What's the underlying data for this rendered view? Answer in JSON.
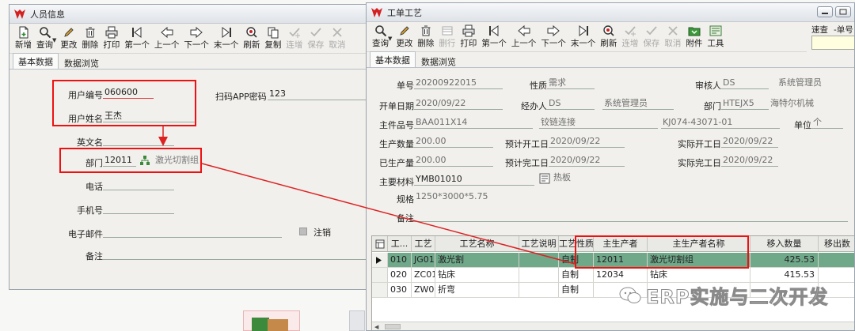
{
  "left_window": {
    "title": "人员信息",
    "toolbar": [
      {
        "label": "新增",
        "icon": "new-doc-icon"
      },
      {
        "label": "查询",
        "icon": "search-icon",
        "dropdown": true
      },
      {
        "label": "更改",
        "icon": "pencil-icon"
      },
      {
        "label": "删除",
        "icon": "trash-icon"
      },
      {
        "label": "打印",
        "icon": "printer-icon"
      },
      {
        "label": "第一个",
        "icon": "first-record-icon"
      },
      {
        "label": "上一个",
        "icon": "prev-record-icon"
      },
      {
        "label": "下一个",
        "icon": "next-record-icon"
      },
      {
        "label": "末一个",
        "icon": "last-record-icon"
      },
      {
        "label": "刷新",
        "icon": "refresh-icon"
      },
      {
        "label": "复制",
        "icon": "copy-icon"
      },
      {
        "label": "连增",
        "icon": "check-plus-icon",
        "disabled": true
      },
      {
        "label": "保存",
        "icon": "check-icon",
        "disabled": true
      },
      {
        "label": "取消",
        "icon": "cancel-icon",
        "disabled": true
      }
    ],
    "tabs": [
      "基本数据",
      "数据浏览"
    ],
    "fields": {
      "user_code_label": "用户编号",
      "user_code": "060600",
      "user_name_label": "用户姓名",
      "user_name": "王杰",
      "english_name_label": "英文名",
      "english_name": "",
      "dept_label": "部门",
      "dept_code": "12011",
      "dept_name": "激光切割组",
      "phone_label": "电话",
      "phone": "",
      "mobile_label": "手机号",
      "mobile": "",
      "email_label": "电子邮件",
      "email": "",
      "remark_label": "备注",
      "remark": "",
      "app_pwd_label": "扫码APP密码",
      "app_pwd": "123",
      "cancel_label": "注销"
    }
  },
  "right_window": {
    "title": "工单工艺",
    "toolbar": [
      {
        "label": "查询",
        "icon": "search-icon",
        "dropdown": true
      },
      {
        "label": "更改",
        "icon": "pencil-icon"
      },
      {
        "label": "删除",
        "icon": "trash-icon"
      },
      {
        "label": "删行",
        "icon": "delete-row-icon",
        "disabled": true
      },
      {
        "label": "打印",
        "icon": "printer-icon"
      },
      {
        "label": "第一个",
        "icon": "first-record-icon"
      },
      {
        "label": "上一个",
        "icon": "prev-record-icon"
      },
      {
        "label": "下一个",
        "icon": "next-record-icon"
      },
      {
        "label": "末一个",
        "icon": "last-record-icon"
      },
      {
        "label": "刷新",
        "icon": "refresh-icon"
      },
      {
        "label": "连增",
        "icon": "check-plus-icon",
        "disabled": true
      },
      {
        "label": "保存",
        "icon": "check-icon",
        "disabled": true
      },
      {
        "label": "取消",
        "icon": "cancel-icon",
        "disabled": true
      },
      {
        "label": "附件",
        "icon": "folder-icon"
      },
      {
        "label": "工具",
        "icon": "tools-icon"
      }
    ],
    "quick_search_label": "速查",
    "quick_search_field": "-单号",
    "tabs": [
      "基本数据",
      "数据浏览"
    ],
    "fields": {
      "order_no_label": "单号",
      "order_no": "20200922015",
      "nature_label": "性质",
      "nature": "需求",
      "reviewer_label": "审核人",
      "reviewer": "DS",
      "reviewer_name": "系统管理员",
      "open_date_label": "开单日期",
      "open_date": "2020/09/22",
      "handler_label": "经办人",
      "handler": "DS",
      "handler_name": "系统管理员",
      "dept_label": "部门",
      "dept": "HTEJX5",
      "dept_name": "海特尔机械",
      "main_part_label": "主件品号",
      "main_part": "BAA011X14",
      "main_part_name": "铰链连接",
      "main_part_spec": "KJ074-43071-01",
      "unit_label": "单位",
      "unit": "个",
      "prod_qty_label": "生产数量",
      "prod_qty": "200.00",
      "plan_start_label": "预计开工日",
      "plan_start": "2020/09/22",
      "act_start_label": "实际开工日",
      "act_start": "2020/09/22",
      "done_qty_label": "已生产量",
      "done_qty": "200.00",
      "plan_end_label": "预计完工日",
      "plan_end": "2020/09/22",
      "act_end_label": "实际完工日",
      "act_end": "2020/09/22",
      "material_label": "主要材料",
      "material": "YMB01010",
      "material_name": "热板",
      "spec_label": "规格",
      "spec": "1250*3000*5.75",
      "remark_label": "备注",
      "remark": ""
    },
    "grid": {
      "columns": [
        "工...",
        "工艺",
        "工艺名称",
        "工艺说明",
        "工艺性质",
        "主生产者",
        "主生产者名称",
        "移入数量",
        "移出数"
      ],
      "rows": [
        [
          "010",
          "JG01",
          "激光割",
          "",
          "自制",
          "12011",
          "激光切割组",
          "425.53"
        ],
        [
          "020",
          "ZC01",
          "钻床",
          "",
          "自制",
          "12034",
          "钻床",
          "415.53"
        ],
        [
          "030",
          "ZW01",
          "折弯",
          "",
          "自制",
          "",
          "",
          ""
        ]
      ]
    }
  },
  "watermark": {
    "text": "ERP实施与二次开发"
  },
  "colors": {
    "highlight_box": "#ee1111",
    "selected_row": "#70a88a",
    "arrow": "#dd2222"
  }
}
